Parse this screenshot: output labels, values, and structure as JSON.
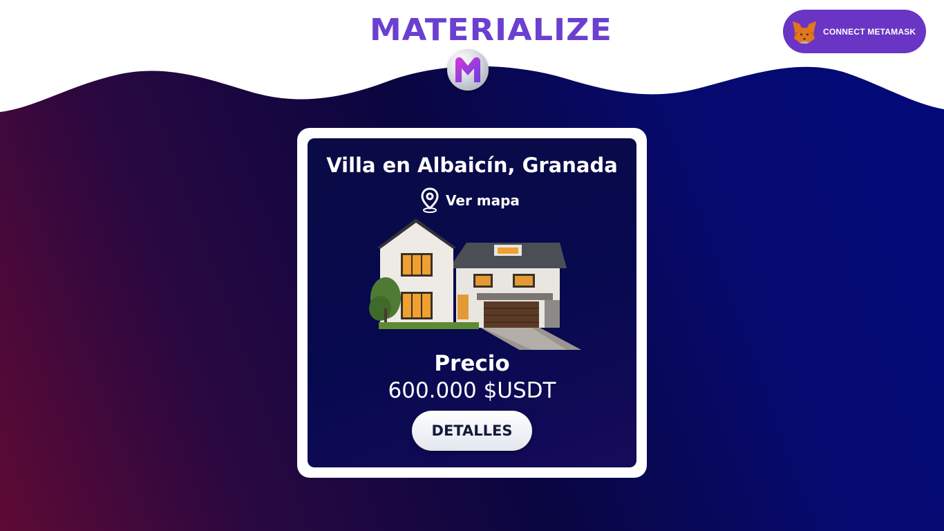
{
  "header": {
    "brand": "MATERIALIZE",
    "logo_letter": "M",
    "connect_label": "CONNECT METAMASK"
  },
  "property": {
    "title": "Villa en Albaicín, Granada",
    "map_link": "Ver mapa",
    "price_label": "Precio",
    "price_value": "600.000 $USDT",
    "details_label": "DETALLES"
  },
  "icons": {
    "logo": "m-logo-icon",
    "metamask": "metamask-fox-icon",
    "map": "location-pin-icon"
  },
  "colors": {
    "brand": "#6b3fd0",
    "button": "#6a34c4",
    "card": "#07094f",
    "bg_left": "#5e0a34",
    "bg_right": "#020a7a"
  }
}
